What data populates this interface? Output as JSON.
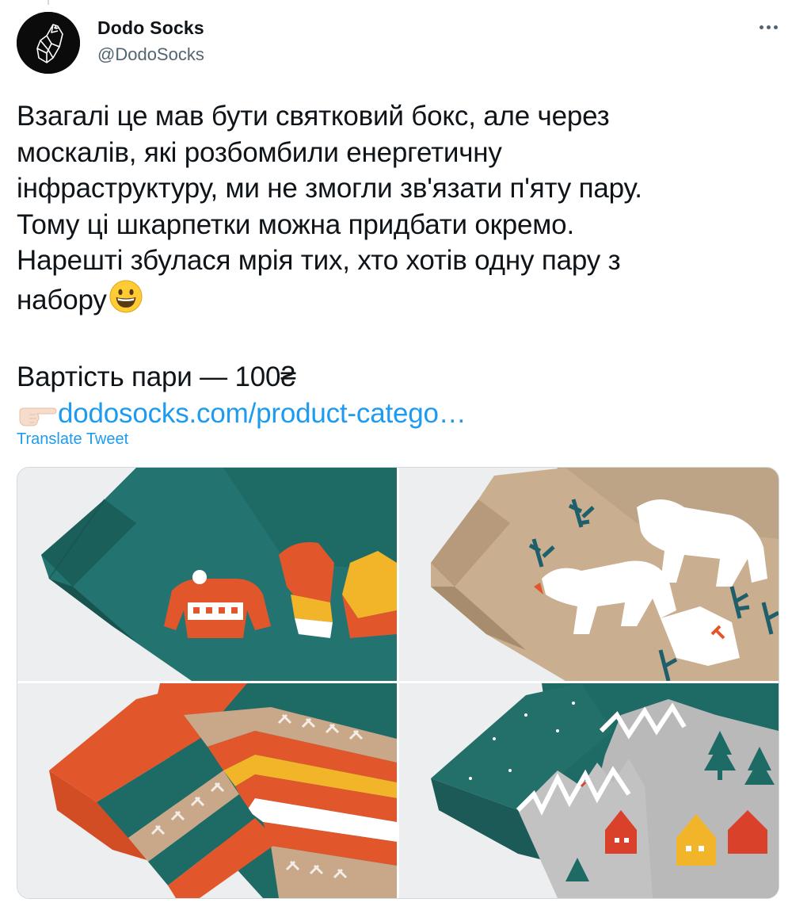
{
  "author": {
    "name": "Dodo Socks",
    "handle": "@DodoSocks",
    "avatar_icon": "dodo-bird-logo"
  },
  "menu_icon": "more-horizontal-icon",
  "tweet": {
    "lines": [
      "Взагалі це мав бути святковий бокс, але через",
      "москалів, які розбомбили енергетичну",
      "інфраструктуру, ми не змогли зв'язати п'яту пару.",
      "Тому ці шкарпетки можна придбати окремо.",
      "Нарешті збулася мрія тих, хто хотів одну пару з",
      "набору"
    ],
    "emoji": "grinning-face-emoji",
    "price_line": "Вартість пари — 100₴",
    "pointer_emoji": "backhand-index-pointing-right-emoji",
    "link_text": "dodosocks.com/product-catego…"
  },
  "translate_label": "Translate Tweet",
  "media": {
    "images": [
      {
        "subject": "teal socks with red sweater pattern",
        "colors": {
          "base": "#1f6b66",
          "accent": "#e2562c",
          "accent2": "#f2b52a"
        }
      },
      {
        "subject": "beige socks with white reindeer pattern",
        "colors": {
          "base": "#c6ab8c",
          "accent": "#ffffff",
          "accent2": "#1f5f6b"
        }
      },
      {
        "subject": "orange and teal fair-isle striped socks",
        "colors": {
          "base": "#1f6b66",
          "accent": "#e2562c",
          "accent2": "#f2b52a"
        }
      },
      {
        "subject": "teal and grey socks with winter houses pattern",
        "colors": {
          "base": "#1f6b66",
          "accent": "#b9b9b9",
          "accent2": "#d9412a"
        }
      }
    ]
  },
  "colors": {
    "link": "#1d9bf0",
    "secondary_text": "#536471",
    "border": "#cfd9de"
  }
}
